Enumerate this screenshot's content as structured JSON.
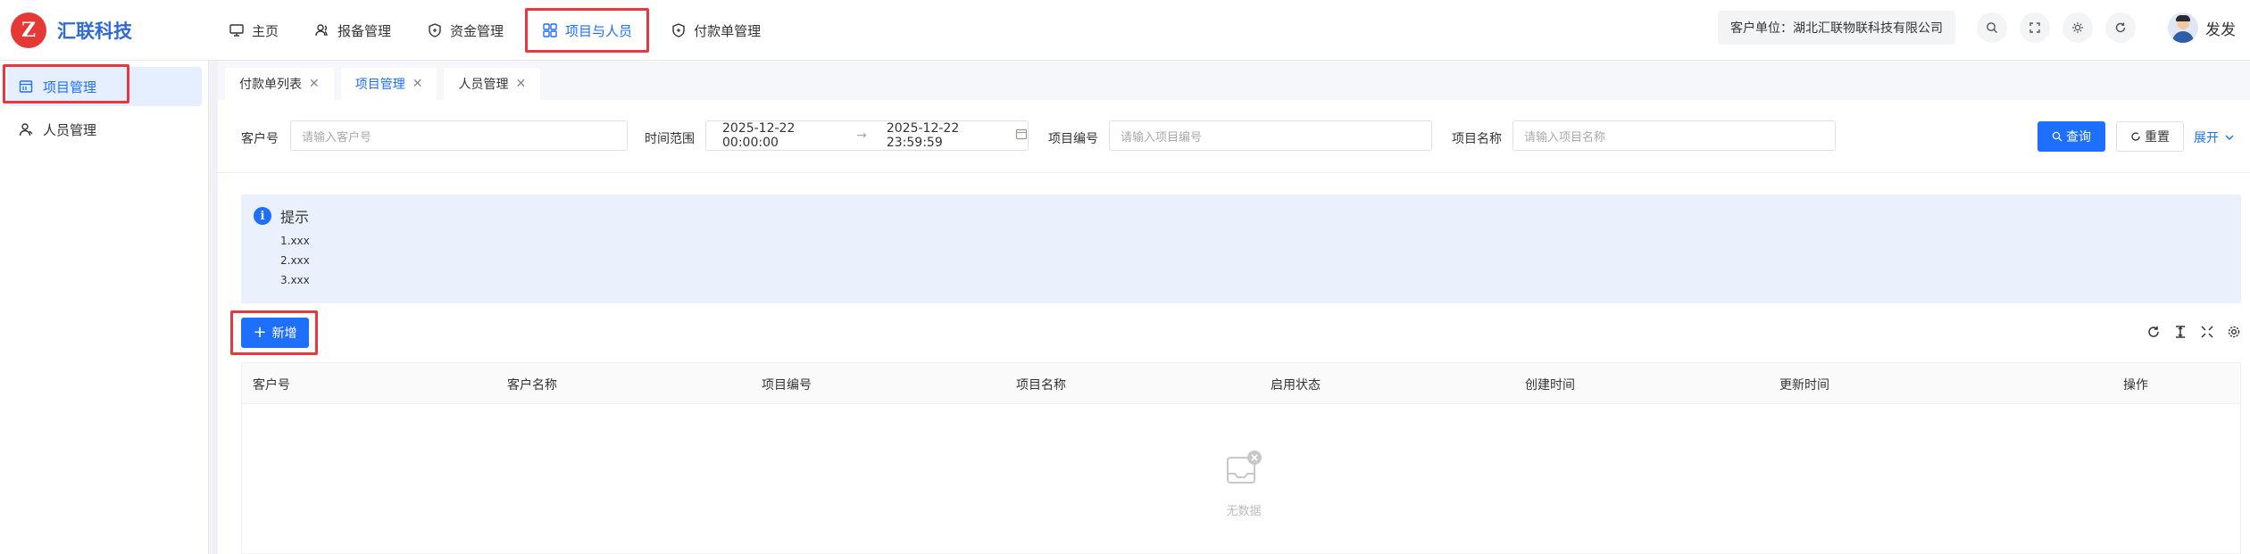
{
  "brand": {
    "name": "汇联科技"
  },
  "topnav": {
    "items": [
      {
        "label": "主页",
        "icon": "monitor-icon"
      },
      {
        "label": "报备管理",
        "icon": "users-icon"
      },
      {
        "label": "资金管理",
        "icon": "shield-icon"
      },
      {
        "label": "项目与人员",
        "icon": "grid-icon",
        "active": true
      },
      {
        "label": "付款单管理",
        "icon": "shield-icon"
      }
    ]
  },
  "header": {
    "org": "客户单位：湖北汇联物联科技有限公司",
    "user_name": "发发"
  },
  "sidebar": {
    "items": [
      {
        "label": "项目管理",
        "icon": "calendar-icon",
        "active": true
      },
      {
        "label": "人员管理",
        "icon": "user-icon"
      }
    ]
  },
  "tabs": [
    {
      "label": "付款单列表"
    },
    {
      "label": "项目管理",
      "active": true
    },
    {
      "label": "人员管理"
    }
  ],
  "filters": {
    "customer_no_label": "客户号",
    "customer_no_placeholder": "请输入客户号",
    "time_range_label": "时间范围",
    "time_start": "2025-12-22 00:00:00",
    "time_end": "2025-12-22 23:59:59",
    "project_no_label": "项目编号",
    "project_no_placeholder": "请输入项目编号",
    "project_name_label": "项目名称",
    "project_name_placeholder": "请输入项目名称",
    "search_label": "查询",
    "reset_label": "重置",
    "expand_label": "展开"
  },
  "notice": {
    "title": "提示",
    "lines": [
      "1.xxx",
      "2.xxx",
      "3.xxx"
    ]
  },
  "toolbar": {
    "add_label": "新增"
  },
  "table": {
    "columns": [
      "客户号",
      "客户名称",
      "项目编号",
      "项目名称",
      "启用状态",
      "创建时间",
      "更新时间",
      "操作"
    ],
    "rows": [],
    "empty_text": "无数据"
  },
  "colors": {
    "primary": "#1f6fff",
    "highlight": "#e8383d",
    "brand_logo": "#e53935"
  }
}
